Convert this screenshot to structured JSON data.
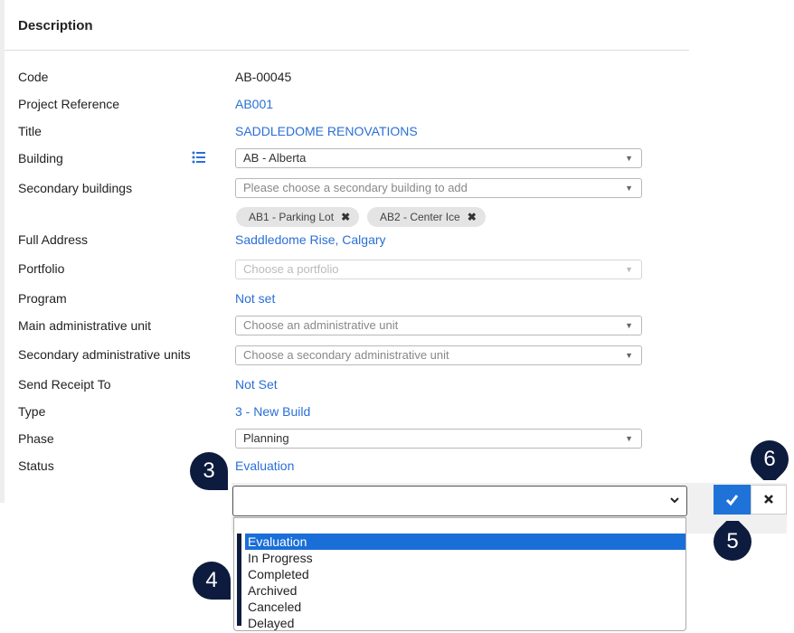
{
  "description": {
    "title": "Description"
  },
  "fields": {
    "code": {
      "label": "Code",
      "value": "AB-00045"
    },
    "project_reference": {
      "label": "Project Reference",
      "value": "AB001"
    },
    "title": {
      "label": "Title",
      "value": "SADDLEDOME RENOVATIONS"
    },
    "building": {
      "label": "Building",
      "value": "AB - Alberta"
    },
    "secondary_buildings": {
      "label": "Secondary buildings",
      "placeholder": "Please choose a secondary building to add",
      "chips": [
        "AB1 - Parking Lot",
        "AB2 - Center Ice"
      ]
    },
    "full_address": {
      "label": "Full Address",
      "value": "Saddledome Rise, Calgary"
    },
    "portfolio": {
      "label": "Portfolio",
      "placeholder": "Choose a portfolio"
    },
    "program": {
      "label": "Program",
      "value": "Not set"
    },
    "main_admin_unit": {
      "label": "Main administrative unit",
      "placeholder": "Choose an administrative unit"
    },
    "secondary_admin_units": {
      "label": "Secondary administrative units",
      "placeholder": "Choose a secondary administrative unit"
    },
    "send_receipt_to": {
      "label": "Send Receipt To",
      "value": "Not Set"
    },
    "type": {
      "label": "Type",
      "value": "3 - New Build"
    },
    "phase": {
      "label": "Phase",
      "value": "Planning"
    },
    "status": {
      "label": "Status",
      "value": "Evaluation"
    }
  },
  "status_dropdown": {
    "selected": "Evaluation",
    "options": [
      "Evaluation",
      "In Progress",
      "Completed",
      "Archived",
      "Canceled",
      "Delayed"
    ]
  },
  "callouts": {
    "c3": "3",
    "c4": "4",
    "c5": "5",
    "c6": "6"
  },
  "colors": {
    "link": "#2a6fd6",
    "accent": "#1f73d8",
    "callout": "#0d1b3e"
  },
  "icons": {
    "building_list": "list-icon",
    "confirm": "check-icon",
    "cancel": "close-icon",
    "chip_remove": "close-icon",
    "dropdown": "caret-down-icon"
  }
}
